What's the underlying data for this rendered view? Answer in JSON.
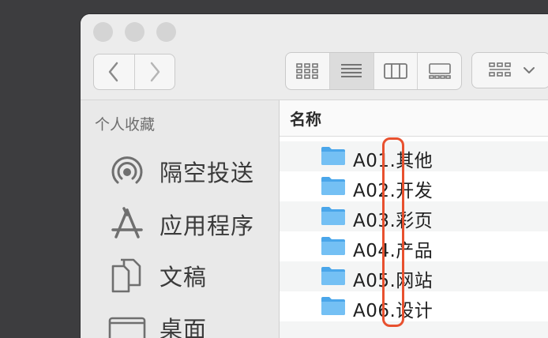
{
  "window": {
    "sidebar": {
      "heading": "个人收藏",
      "items": [
        {
          "label": "隔空投送",
          "icon": "airdrop-icon"
        },
        {
          "label": "应用程序",
          "icon": "applications-icon"
        },
        {
          "label": "文稿",
          "icon": "documents-icon"
        },
        {
          "label": "桌面",
          "icon": "desktop-icon"
        }
      ]
    },
    "content": {
      "column_header": "名称",
      "files": [
        {
          "name": "A01.其他",
          "icon": "folder-icon"
        },
        {
          "name": "A02.开发",
          "icon": "folder-icon"
        },
        {
          "name": "A03.彩页",
          "icon": "folder-icon"
        },
        {
          "name": "A04.产品",
          "icon": "folder-icon"
        },
        {
          "name": "A05.网站",
          "icon": "folder-icon"
        },
        {
          "name": "A06.设计",
          "icon": "folder-icon"
        }
      ]
    }
  },
  "colors": {
    "highlight": "#e8512f",
    "folder": "#5eb4f0"
  }
}
